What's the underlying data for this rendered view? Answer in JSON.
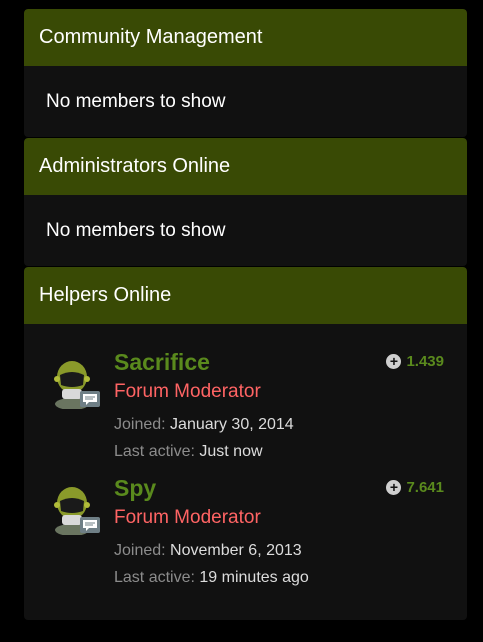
{
  "panels": {
    "community": {
      "title": "Community Management",
      "empty": "No members to show"
    },
    "admins": {
      "title": "Administrators Online",
      "empty": "No members to show"
    },
    "helpers": {
      "title": "Helpers Online",
      "members": [
        {
          "name": "Sacrifice",
          "rank": "Forum Moderator",
          "joined_label": "Joined:",
          "joined_value": "January 30, 2014",
          "active_label": "Last active:",
          "active_value": "Just now",
          "reputation": "1.439",
          "avatar_icon": "soldier-helmet-avatar"
        },
        {
          "name": "Spy",
          "rank": "Forum Moderator",
          "joined_label": "Joined:",
          "joined_value": "November 6, 2013",
          "active_label": "Last active:",
          "active_value": "19 minutes ago",
          "reputation": "7.641",
          "avatar_icon": "soldier-helmet-avatar"
        }
      ]
    }
  },
  "colors": {
    "header_bg": "#394a05",
    "panel_bg": "#111111",
    "member_name": "#5a8a1d",
    "rank": "#ff6464"
  },
  "icons": {
    "reputation": "plus-circle-icon"
  }
}
